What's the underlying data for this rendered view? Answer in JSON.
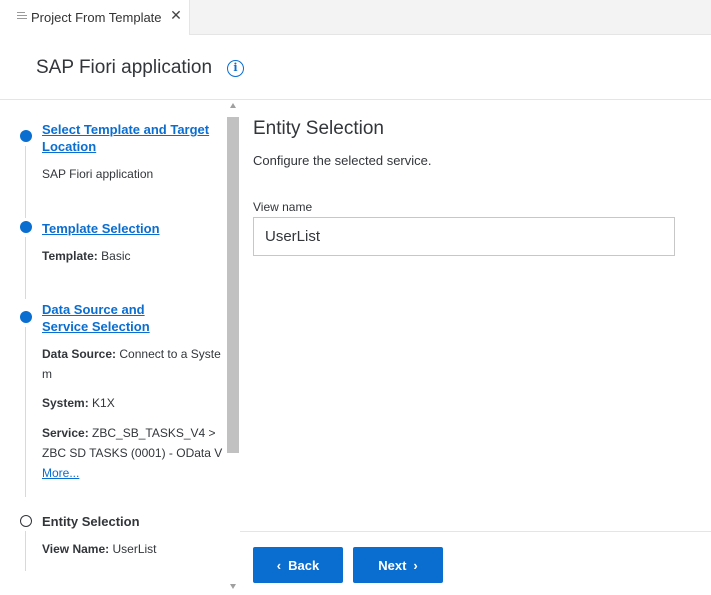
{
  "tab": {
    "title": "Project From Template",
    "menu_icon": "menu-icon",
    "close_icon": "close-icon"
  },
  "header": {
    "title": "SAP Fiori application",
    "info_icon": "info-icon"
  },
  "steps": [
    {
      "title": "Select Template and Target Location",
      "status": "completed",
      "details": [
        {
          "text": "SAP Fiori application"
        }
      ]
    },
    {
      "title": "Template Selection",
      "status": "completed",
      "details": [
        {
          "label": "Template:",
          "value": "Basic"
        }
      ]
    },
    {
      "title": "Data Source and Service Selection",
      "status": "completed",
      "details": [
        {
          "label": "Data Source:",
          "value": "Connect to a System"
        },
        {
          "label": "System:",
          "value": "K1X"
        },
        {
          "label": "Service:",
          "value": "ZBC_SB_TASKS_V4 > ZBC SD TASKS (0001) - OData V"
        }
      ],
      "more": "More..."
    },
    {
      "title": "Entity Selection",
      "status": "current",
      "details": [
        {
          "label": "View Name:",
          "value": "UserList"
        }
      ]
    }
  ],
  "content": {
    "title": "Entity Selection",
    "description": "Configure the selected service.",
    "view_name_label": "View name",
    "view_name_value": "UserList"
  },
  "footer": {
    "back_label": "Back",
    "next_label": "Next"
  },
  "colors": {
    "accent": "#0a6ed1",
    "text": "#32363a"
  }
}
